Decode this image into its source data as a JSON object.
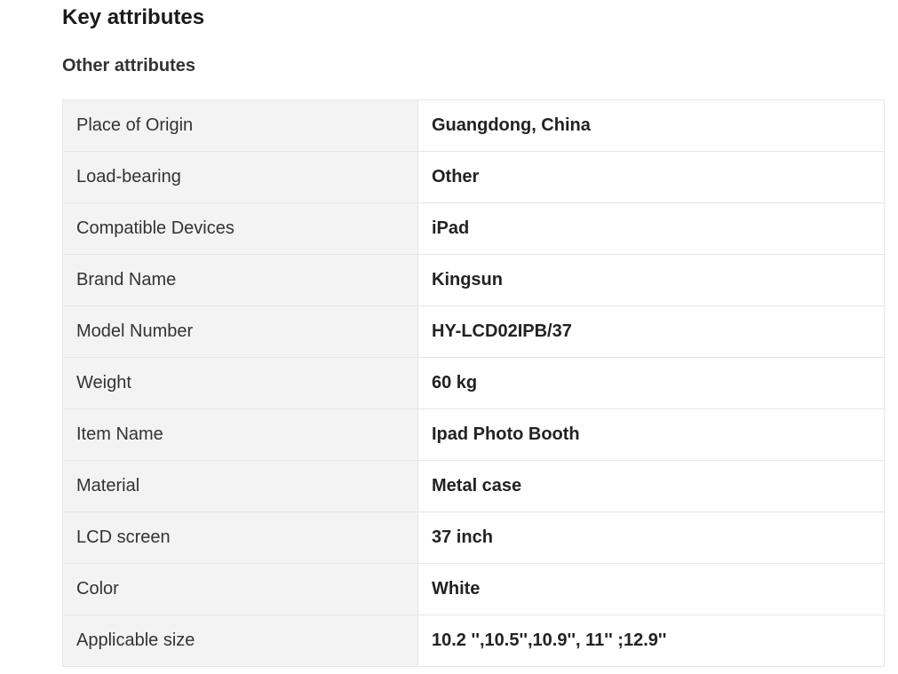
{
  "section": {
    "title": "Key attributes",
    "subtitle": "Other attributes"
  },
  "attributes": [
    {
      "key": "Place of Origin",
      "value": "Guangdong, China"
    },
    {
      "key": "Load-bearing",
      "value": "Other"
    },
    {
      "key": "Compatible Devices",
      "value": "iPad"
    },
    {
      "key": "Brand Name",
      "value": "Kingsun"
    },
    {
      "key": "Model Number",
      "value": "HY-LCD02IPB/37"
    },
    {
      "key": "Weight",
      "value": "60 kg"
    },
    {
      "key": "Item Name",
      "value": "Ipad Photo Booth"
    },
    {
      "key": "Material",
      "value": "Metal case"
    },
    {
      "key": "LCD screen",
      "value": "37 inch"
    },
    {
      "key": "Color",
      "value": "White"
    },
    {
      "key": "Applicable size",
      "value": "10.2 '',10.5'',10.9'', 11'' ;12.9''"
    }
  ]
}
